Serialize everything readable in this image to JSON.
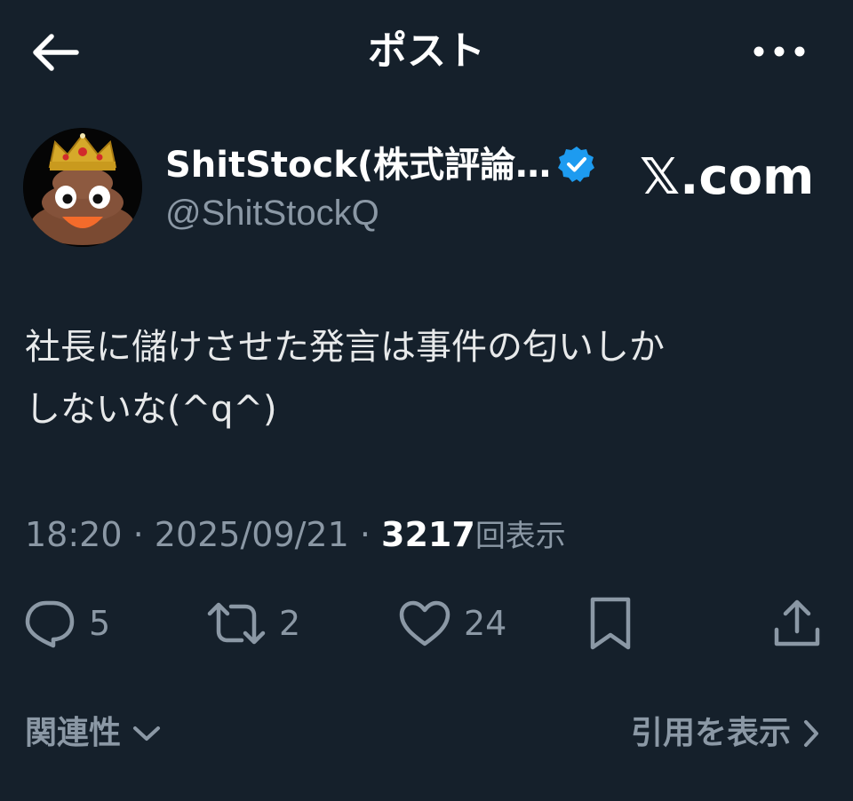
{
  "header": {
    "title": "ポスト",
    "back_icon": "arrow-left-icon",
    "more_icon": "more-horizontal-icon"
  },
  "author": {
    "display_name": "ShitStock(株式評論…",
    "handle": "@ShitStockQ",
    "verified": true,
    "avatar_icon": "crowned-poop-avatar"
  },
  "watermark": "𝕏.com",
  "post": {
    "text": "社長に儲けさせた発言は事件の匂いしか\nしないな(^q^)"
  },
  "meta": {
    "time": "18:20",
    "separator": " · ",
    "date": "2025/09/21",
    "views_count": "3217",
    "views_label": "回表示"
  },
  "actions": {
    "reply_count": "5",
    "retweet_count": "2",
    "like_count": "24"
  },
  "footer": {
    "related_label": "関連性",
    "quotes_label": "引用を表示"
  },
  "colors": {
    "background": "#15202b",
    "text_primary": "#e7e9ea",
    "text_secondary": "#8b98a5",
    "verified_blue": "#1d9bf0"
  }
}
